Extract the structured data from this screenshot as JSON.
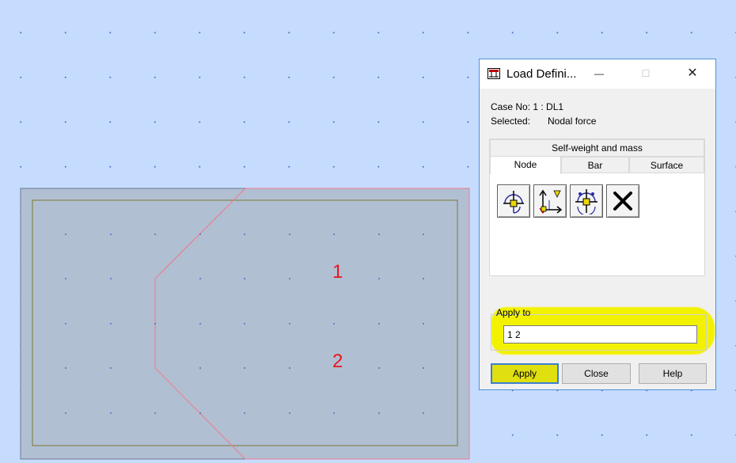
{
  "canvas": {
    "node_labels": [
      "1",
      "2"
    ]
  },
  "dialog": {
    "title": "Load Defini...",
    "controls": {
      "minimize": "—",
      "maximize": "☐",
      "close": "✕"
    },
    "case_line": "Case No: 1 : DL1",
    "selected_label": "Selected:",
    "selected_value": "Nodal force",
    "tabs": {
      "top": "Self-weight and mass",
      "row": [
        "Node",
        "Bar",
        "Surface"
      ],
      "active": "Node"
    },
    "tools": [
      {
        "icon": "nodal-force-icon"
      },
      {
        "icon": "imposed-displacement-icon"
      },
      {
        "icon": "auxiliary-node-force-icon"
      },
      {
        "icon": "delete-load-icon"
      }
    ],
    "apply_to": {
      "label": "Apply to",
      "value": "1 2"
    },
    "buttons": {
      "apply": "Apply",
      "close": "Close",
      "help": "Help"
    },
    "colors": {
      "highlight": "#f2f200",
      "border": "#4f90d8"
    }
  }
}
